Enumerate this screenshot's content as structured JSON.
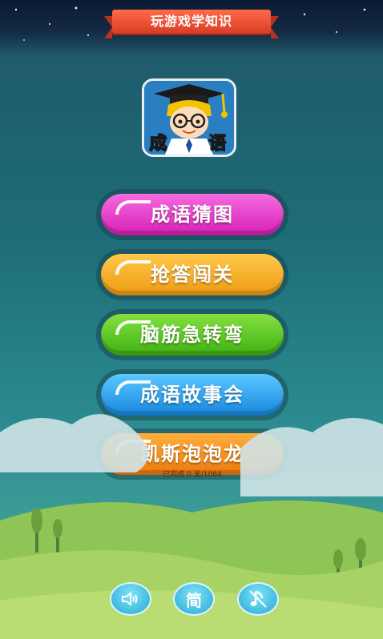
{
  "banner": {
    "title": "玩游戏学知识"
  },
  "logo": {
    "text_left": "成",
    "text_right": "语"
  },
  "menu": [
    {
      "label": "成语猜图",
      "color": "#e23bc4"
    },
    {
      "label": "抢答闯关",
      "color": "#f2a51c"
    },
    {
      "label": "脑筋急转弯",
      "color": "#57c51b"
    },
    {
      "label": "成语故事会",
      "color": "#1f9be8"
    },
    {
      "label": "凯斯泡泡龙",
      "color": "#f28516"
    }
  ],
  "progress_text": "已完成 0 关/1064",
  "bottom": {
    "sound_icon": "speaker-icon",
    "lang_label": "简",
    "music_icon": "music-note-muted-icon"
  }
}
